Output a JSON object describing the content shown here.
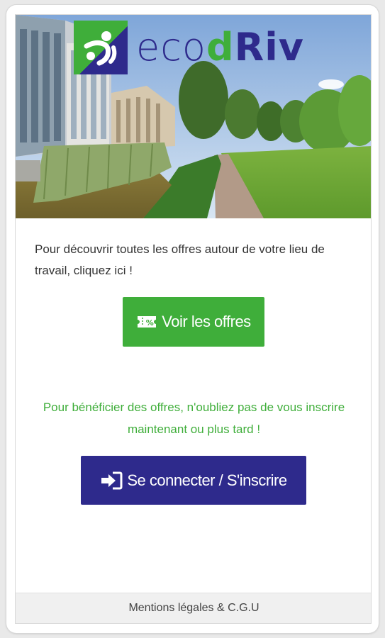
{
  "brand": {
    "logo_prefix": "eco",
    "logo_d": "d",
    "logo_suffix": "Riv",
    "colors": {
      "green": "#3fae3a",
      "navy": "#2e2a8c"
    }
  },
  "hero": {
    "image": "office-park-photo"
  },
  "intro_text": "Pour découvrir toutes les offres autour de votre lieu de travail, cliquez ici !",
  "offers_button": {
    "label": "Voir les offres",
    "icon": "discount-ticket-icon"
  },
  "reminder_text": "Pour bénéficier des offres, n'oubliez pas de vous inscrire maintenant ou plus tard !",
  "login_button": {
    "label": "Se connecter / S'inscrire",
    "icon": "sign-in-icon"
  },
  "footer": {
    "link_label": "Mentions légales & C.G.U"
  }
}
